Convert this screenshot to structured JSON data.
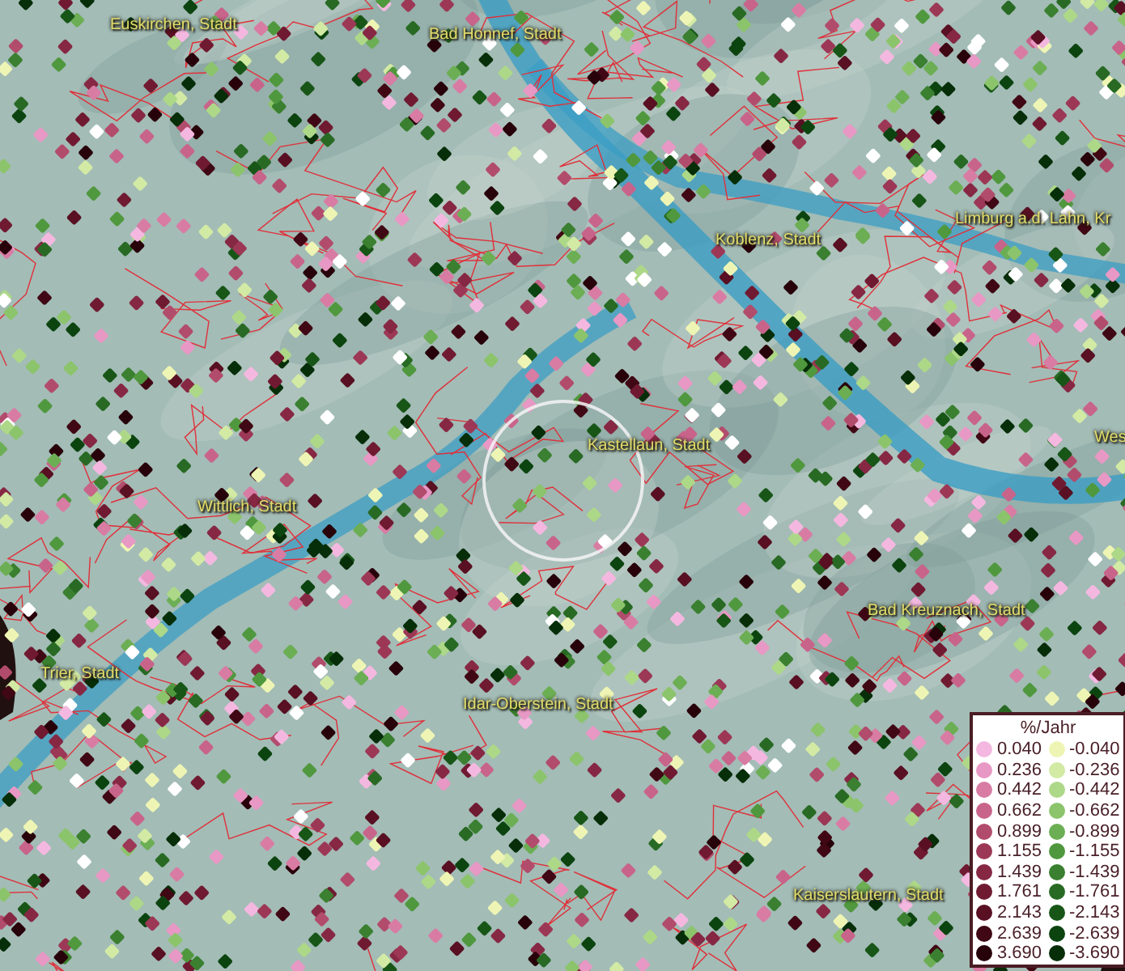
{
  "map": {
    "place_labels": [
      {
        "text": "Euskirchen, Stadt"
      },
      {
        "text": "Bad Honnef, Stadt"
      },
      {
        "text": "Koblenz, Stadt"
      },
      {
        "text": "Limburg a.d. Lahn, Kr"
      },
      {
        "text": "Kastellaun, Stadt"
      },
      {
        "text": "Wes"
      },
      {
        "text": "Wittlich, Stadt"
      },
      {
        "text": "Bad Kreuznach, Stadt"
      },
      {
        "text": "Trier, Stadt"
      },
      {
        "text": "Idar-Oberstein, Stadt"
      },
      {
        "text": "Kaiserslautern, Stadt"
      }
    ]
  },
  "legend": {
    "title": "%/Jahr",
    "entries": [
      {
        "label": "0.040",
        "color": "#f4b8e0"
      },
      {
        "label": "-0.040",
        "color": "#eef5b4"
      },
      {
        "label": "0.236",
        "color": "#e898c4"
      },
      {
        "label": "-0.236",
        "color": "#d2eaa4"
      },
      {
        "label": "0.442",
        "color": "#d87ca4"
      },
      {
        "label": "-0.442",
        "color": "#add888"
      },
      {
        "label": "0.662",
        "color": "#c8648a"
      },
      {
        "label": "-0.662",
        "color": "#8cc46c"
      },
      {
        "label": "0.899",
        "color": "#b24c6c"
      },
      {
        "label": "-0.899",
        "color": "#6cae54"
      },
      {
        "label": "1.155",
        "color": "#9c3856"
      },
      {
        "label": "-1.155",
        "color": "#50983e"
      },
      {
        "label": "1.439",
        "color": "#862844"
      },
      {
        "label": "-1.439",
        "color": "#3a8030"
      },
      {
        "label": "1.761",
        "color": "#701a32"
      },
      {
        "label": "-1.761",
        "color": "#286a24"
      },
      {
        "label": "2.143",
        "color": "#581022"
      },
      {
        "label": "-2.143",
        "color": "#185618"
      },
      {
        "label": "2.639",
        "color": "#400814"
      },
      {
        "label": "-2.639",
        "color": "#0c4410"
      },
      {
        "label": "3.690",
        "color": "#28020a"
      },
      {
        "label": "-3.690",
        "color": "#062e08"
      }
    ]
  }
}
